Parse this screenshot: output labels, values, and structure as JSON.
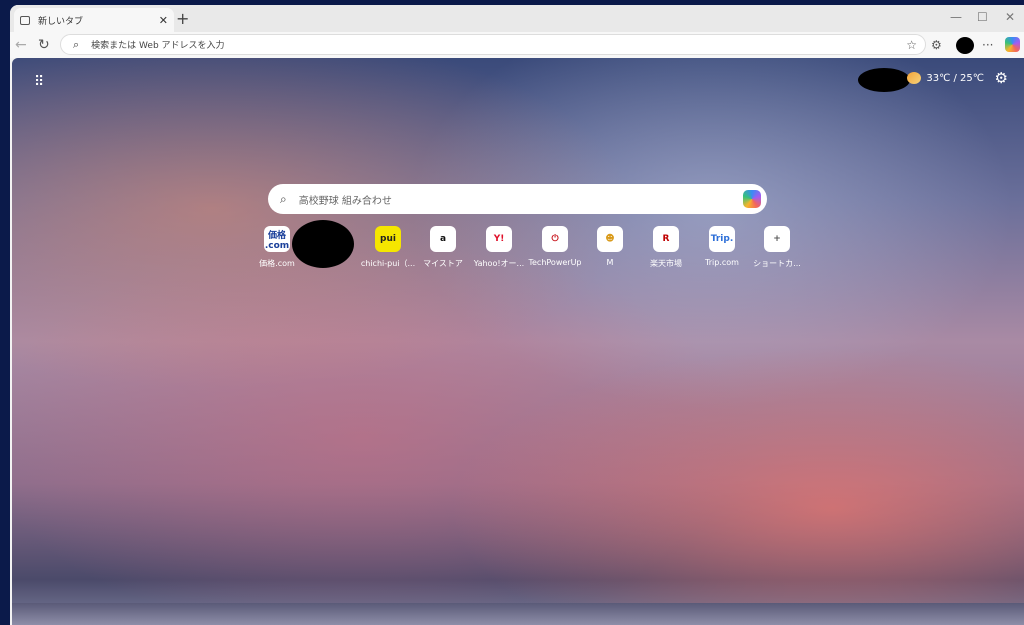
{
  "tab": {
    "title": "新しいタブ"
  },
  "address": {
    "placeholder": "検索または Web アドレスを入力"
  },
  "weather": {
    "text": "33℃ / 25℃"
  },
  "search": {
    "placeholder": "高校野球 組み合わせ"
  },
  "shortcuts": [
    {
      "label": "価格.com",
      "icon": "価格\n.com",
      "color": "#1a3f9a"
    },
    {
      "label": "",
      "icon": "",
      "color": "#000"
    },
    {
      "label": "chichi-pui（...",
      "icon": "pui",
      "color": "#222"
    },
    {
      "label": "マイストア",
      "icon": "a",
      "color": "#111"
    },
    {
      "label": "Yahoo!オー...",
      "icon": "Y!",
      "color": "#e0102a"
    },
    {
      "label": "TechPowerUp",
      "icon": "⏻",
      "color": "#c8171e"
    },
    {
      "label": "M",
      "icon": "☻",
      "color": "#d99a1a"
    },
    {
      "label": "楽天市場",
      "icon": "R",
      "color": "#bf0000"
    },
    {
      "label": "Trip.com",
      "icon": "Trip.",
      "color": "#2d6fd8"
    },
    {
      "label": "ショートカ...",
      "icon": "+",
      "color": "#555"
    }
  ]
}
